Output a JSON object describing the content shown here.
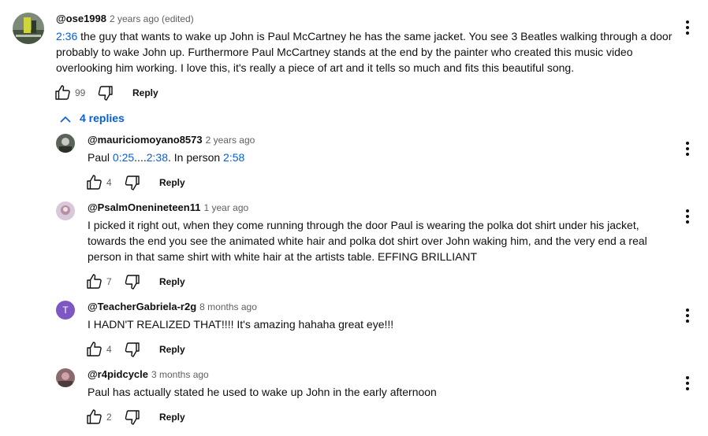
{
  "comments": [
    {
      "author": "@ose1998",
      "time": "2 years ago (edited)",
      "segments": [
        {
          "type": "timestamp",
          "text": "2:36"
        },
        {
          "type": "text",
          "text": " the guy that wants to wake up John is Paul McCartney he has the same jacket. You see 3 Beatles walking through a door probably to wake John up. Furthermore Paul McCartney stands at the end by the painter who created this music video overlooking him working. I love this, it's really a piece of art and it tells so much and fits this beautiful song."
        }
      ],
      "likes": "99",
      "reply_label": "Reply",
      "avatar_colors": [
        "#3b4a3a",
        "#c9cf2a",
        "#8a9486"
      ]
    }
  ],
  "replies_toggle": {
    "label": "4 replies",
    "icon": "chevron-up-icon"
  },
  "replies": [
    {
      "author": "@mauriciomoyano8573",
      "time": "2 years ago",
      "segments": [
        {
          "type": "text",
          "text": "Paul "
        },
        {
          "type": "timestamp",
          "text": "0:25"
        },
        {
          "type": "text",
          "text": "...."
        },
        {
          "type": "timestamp",
          "text": "2:38"
        },
        {
          "type": "text",
          "text": ". In person "
        },
        {
          "type": "timestamp",
          "text": "2:58"
        }
      ],
      "likes": "4",
      "reply_label": "Reply"
    },
    {
      "author": "@PsalmOnenineteen11",
      "time": "1 year ago",
      "segments": [
        {
          "type": "text",
          "text": "I picked it right out, when they come running through the door Paul is wearing the polka dot shirt under his jacket, towards the end you see the animated white hair and polka dot shirt over John waking him, and the very end a real person in that same shirt with white hair at the artists table. EFFING BRILLIANT"
        }
      ],
      "likes": "7",
      "reply_label": "Reply"
    },
    {
      "author": "@TeacherGabriela-r2g",
      "time": "8 months ago",
      "segments": [
        {
          "type": "text",
          "text": "I HADN'T REALIZED THAT!!!! It's amazing hahaha great eye!!!"
        }
      ],
      "likes": "4",
      "reply_label": "Reply",
      "avatar_letter": "T",
      "avatar_color": "#7e57c2"
    },
    {
      "author": "@r4pidcycle",
      "time": "3 months ago",
      "segments": [
        {
          "type": "text",
          "text": "Paul has actually stated he used to wake up John in the early afternoon"
        }
      ],
      "likes": "2",
      "reply_label": "Reply"
    }
  ],
  "icons": {
    "like": "thumbs-up-icon",
    "dislike": "thumbs-down-icon",
    "menu": "more-vert-icon"
  },
  "colors": {
    "timestamp_link": "#065fd4",
    "secondary_text": "#606060",
    "letter_avatar": "#7e57c2"
  }
}
